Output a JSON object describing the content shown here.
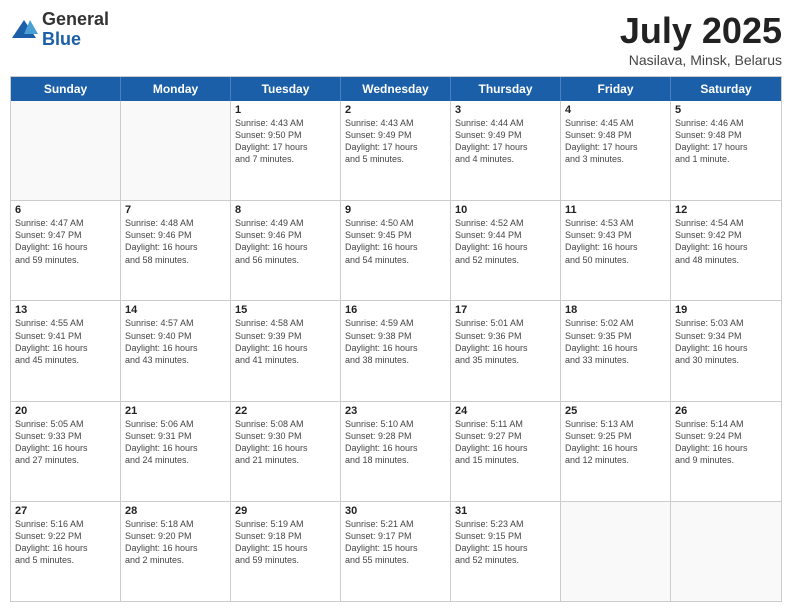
{
  "header": {
    "logo": {
      "line1": "General",
      "line2": "Blue"
    },
    "title": "July 2025",
    "location": "Nasilava, Minsk, Belarus"
  },
  "days_of_week": [
    "Sunday",
    "Monday",
    "Tuesday",
    "Wednesday",
    "Thursday",
    "Friday",
    "Saturday"
  ],
  "weeks": [
    [
      {
        "day": "",
        "lines": []
      },
      {
        "day": "",
        "lines": []
      },
      {
        "day": "1",
        "lines": [
          "Sunrise: 4:43 AM",
          "Sunset: 9:50 PM",
          "Daylight: 17 hours",
          "and 7 minutes."
        ]
      },
      {
        "day": "2",
        "lines": [
          "Sunrise: 4:43 AM",
          "Sunset: 9:49 PM",
          "Daylight: 17 hours",
          "and 5 minutes."
        ]
      },
      {
        "day": "3",
        "lines": [
          "Sunrise: 4:44 AM",
          "Sunset: 9:49 PM",
          "Daylight: 17 hours",
          "and 4 minutes."
        ]
      },
      {
        "day": "4",
        "lines": [
          "Sunrise: 4:45 AM",
          "Sunset: 9:48 PM",
          "Daylight: 17 hours",
          "and 3 minutes."
        ]
      },
      {
        "day": "5",
        "lines": [
          "Sunrise: 4:46 AM",
          "Sunset: 9:48 PM",
          "Daylight: 17 hours",
          "and 1 minute."
        ]
      }
    ],
    [
      {
        "day": "6",
        "lines": [
          "Sunrise: 4:47 AM",
          "Sunset: 9:47 PM",
          "Daylight: 16 hours",
          "and 59 minutes."
        ]
      },
      {
        "day": "7",
        "lines": [
          "Sunrise: 4:48 AM",
          "Sunset: 9:46 PM",
          "Daylight: 16 hours",
          "and 58 minutes."
        ]
      },
      {
        "day": "8",
        "lines": [
          "Sunrise: 4:49 AM",
          "Sunset: 9:46 PM",
          "Daylight: 16 hours",
          "and 56 minutes."
        ]
      },
      {
        "day": "9",
        "lines": [
          "Sunrise: 4:50 AM",
          "Sunset: 9:45 PM",
          "Daylight: 16 hours",
          "and 54 minutes."
        ]
      },
      {
        "day": "10",
        "lines": [
          "Sunrise: 4:52 AM",
          "Sunset: 9:44 PM",
          "Daylight: 16 hours",
          "and 52 minutes."
        ]
      },
      {
        "day": "11",
        "lines": [
          "Sunrise: 4:53 AM",
          "Sunset: 9:43 PM",
          "Daylight: 16 hours",
          "and 50 minutes."
        ]
      },
      {
        "day": "12",
        "lines": [
          "Sunrise: 4:54 AM",
          "Sunset: 9:42 PM",
          "Daylight: 16 hours",
          "and 48 minutes."
        ]
      }
    ],
    [
      {
        "day": "13",
        "lines": [
          "Sunrise: 4:55 AM",
          "Sunset: 9:41 PM",
          "Daylight: 16 hours",
          "and 45 minutes."
        ]
      },
      {
        "day": "14",
        "lines": [
          "Sunrise: 4:57 AM",
          "Sunset: 9:40 PM",
          "Daylight: 16 hours",
          "and 43 minutes."
        ]
      },
      {
        "day": "15",
        "lines": [
          "Sunrise: 4:58 AM",
          "Sunset: 9:39 PM",
          "Daylight: 16 hours",
          "and 41 minutes."
        ]
      },
      {
        "day": "16",
        "lines": [
          "Sunrise: 4:59 AM",
          "Sunset: 9:38 PM",
          "Daylight: 16 hours",
          "and 38 minutes."
        ]
      },
      {
        "day": "17",
        "lines": [
          "Sunrise: 5:01 AM",
          "Sunset: 9:36 PM",
          "Daylight: 16 hours",
          "and 35 minutes."
        ]
      },
      {
        "day": "18",
        "lines": [
          "Sunrise: 5:02 AM",
          "Sunset: 9:35 PM",
          "Daylight: 16 hours",
          "and 33 minutes."
        ]
      },
      {
        "day": "19",
        "lines": [
          "Sunrise: 5:03 AM",
          "Sunset: 9:34 PM",
          "Daylight: 16 hours",
          "and 30 minutes."
        ]
      }
    ],
    [
      {
        "day": "20",
        "lines": [
          "Sunrise: 5:05 AM",
          "Sunset: 9:33 PM",
          "Daylight: 16 hours",
          "and 27 minutes."
        ]
      },
      {
        "day": "21",
        "lines": [
          "Sunrise: 5:06 AM",
          "Sunset: 9:31 PM",
          "Daylight: 16 hours",
          "and 24 minutes."
        ]
      },
      {
        "day": "22",
        "lines": [
          "Sunrise: 5:08 AM",
          "Sunset: 9:30 PM",
          "Daylight: 16 hours",
          "and 21 minutes."
        ]
      },
      {
        "day": "23",
        "lines": [
          "Sunrise: 5:10 AM",
          "Sunset: 9:28 PM",
          "Daylight: 16 hours",
          "and 18 minutes."
        ]
      },
      {
        "day": "24",
        "lines": [
          "Sunrise: 5:11 AM",
          "Sunset: 9:27 PM",
          "Daylight: 16 hours",
          "and 15 minutes."
        ]
      },
      {
        "day": "25",
        "lines": [
          "Sunrise: 5:13 AM",
          "Sunset: 9:25 PM",
          "Daylight: 16 hours",
          "and 12 minutes."
        ]
      },
      {
        "day": "26",
        "lines": [
          "Sunrise: 5:14 AM",
          "Sunset: 9:24 PM",
          "Daylight: 16 hours",
          "and 9 minutes."
        ]
      }
    ],
    [
      {
        "day": "27",
        "lines": [
          "Sunrise: 5:16 AM",
          "Sunset: 9:22 PM",
          "Daylight: 16 hours",
          "and 5 minutes."
        ]
      },
      {
        "day": "28",
        "lines": [
          "Sunrise: 5:18 AM",
          "Sunset: 9:20 PM",
          "Daylight: 16 hours",
          "and 2 minutes."
        ]
      },
      {
        "day": "29",
        "lines": [
          "Sunrise: 5:19 AM",
          "Sunset: 9:18 PM",
          "Daylight: 15 hours",
          "and 59 minutes."
        ]
      },
      {
        "day": "30",
        "lines": [
          "Sunrise: 5:21 AM",
          "Sunset: 9:17 PM",
          "Daylight: 15 hours",
          "and 55 minutes."
        ]
      },
      {
        "day": "31",
        "lines": [
          "Sunrise: 5:23 AM",
          "Sunset: 9:15 PM",
          "Daylight: 15 hours",
          "and 52 minutes."
        ]
      },
      {
        "day": "",
        "lines": []
      },
      {
        "day": "",
        "lines": []
      }
    ]
  ]
}
